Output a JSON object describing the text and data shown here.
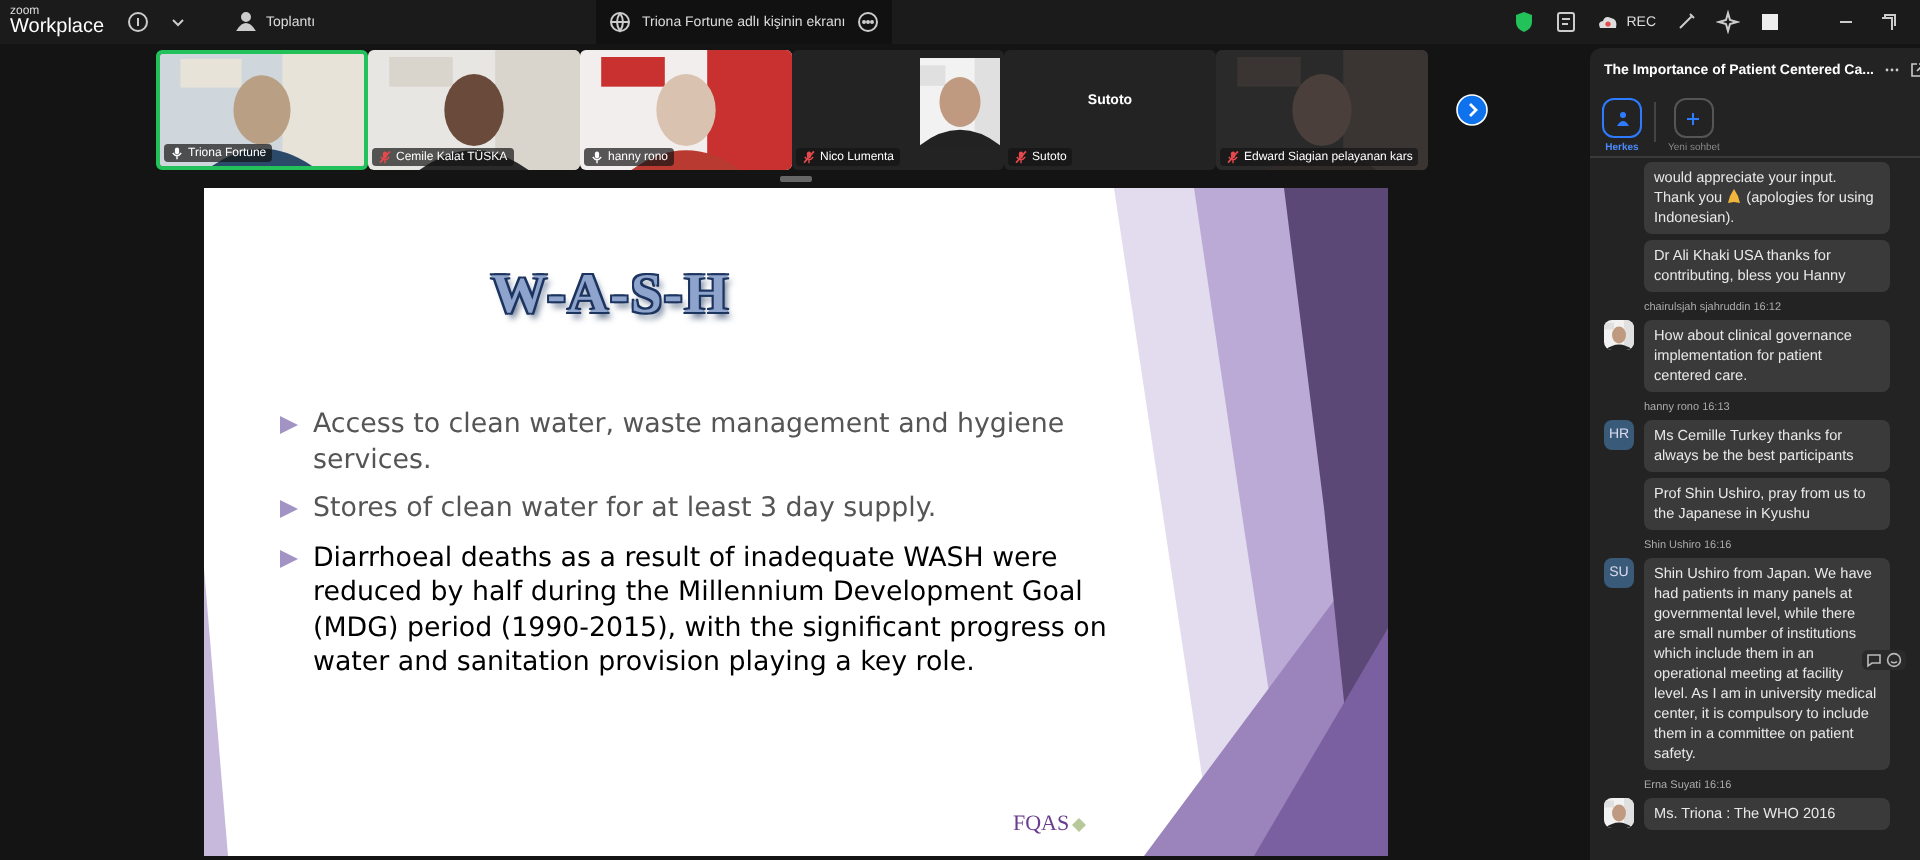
{
  "app": {
    "logo_top": "zoom",
    "logo_bottom": "Workplace",
    "meeting_label": "Toplantı"
  },
  "share_tab": {
    "title": "Triona Fortune adlı kişinin ekranı"
  },
  "toolbar": {
    "record_label": "REC"
  },
  "participants": [
    {
      "name": "Triona Fortune",
      "kind": "video",
      "muted": false,
      "selected": true
    },
    {
      "name": "Cemile Kalat TÜSKA",
      "kind": "video",
      "muted": true,
      "selected": false
    },
    {
      "name": "hanny rono",
      "kind": "video",
      "muted": false,
      "selected": false
    },
    {
      "name": "Nico Lumenta",
      "kind": "avatar",
      "muted": true,
      "selected": false
    },
    {
      "name": "Sutoto",
      "kind": "name",
      "center_name": "Sutoto",
      "muted": true,
      "selected": false
    },
    {
      "name": "Edward Siagian pelayanan kars",
      "kind": "video",
      "muted": true,
      "selected": false
    }
  ],
  "slide": {
    "title": "W-A-S-H",
    "bullets": [
      {
        "text": "Access to clean water, waste management and hygiene services.",
        "dimmed": true
      },
      {
        "text": "Stores of clean water for at least 3 day supply.",
        "dimmed": true
      },
      {
        "text": "Diarrhoeal deaths as a result of inadequate WASH were reduced by half during the Millennium Development Goal (MDG) period (1990-2015), with the significant progress on water and sanitation provision playing a key role.",
        "dimmed": false
      }
    ],
    "logo": "FQAS"
  },
  "chat": {
    "title": "The Importance of Patient Centered Ca...",
    "tabs": [
      {
        "label": "Herkes",
        "kind": "people",
        "selected": true
      },
      {
        "label": "Yeni sohbet",
        "kind": "add",
        "selected": false
      }
    ],
    "groups": [
      {
        "messages": [
          {
            "kind": "emoji",
            "text": "would appreciate your input. Thank you",
            "text_after": "(apologies for using Indonesian)."
          },
          {
            "text": "Dr Ali Khaki USA thanks for contributing, bless you Hanny"
          }
        ]
      },
      {
        "sender": "chairulsjah sjahruddin",
        "time": "16:12",
        "avatar": {
          "kind": "picture"
        },
        "messages": [
          {
            "text": "How about clinical governance implementation for patient centered care."
          }
        ]
      },
      {
        "sender": "hanny rono",
        "time": "16:13",
        "avatar": {
          "kind": "initials",
          "initials": "HR"
        },
        "messages": [
          {
            "text": "Ms Cemille Turkey thanks for always be the best participants"
          },
          {
            "text": "Prof Shin Ushiro, pray from us to the Japanese in Kyushu"
          }
        ]
      },
      {
        "sender": "Shin Ushiro",
        "time": "16:16",
        "avatar": {
          "kind": "initials",
          "initials": "SU"
        },
        "messages": [
          {
            "text": "Shin Ushiro from Japan. We have had patients in many panels at governmental level, while there are small number of institutions which include them in an operational meeting at facility level. As I am in university medical center, it is compulsory to include them in a committee on patient safety.",
            "hovered": true
          }
        ]
      },
      {
        "sender": "Erna Suyati",
        "time": "16:16",
        "avatar": {
          "kind": "picture"
        },
        "messages": [
          {
            "text": "Ms. Triona : The WHO 2016"
          }
        ]
      }
    ]
  }
}
